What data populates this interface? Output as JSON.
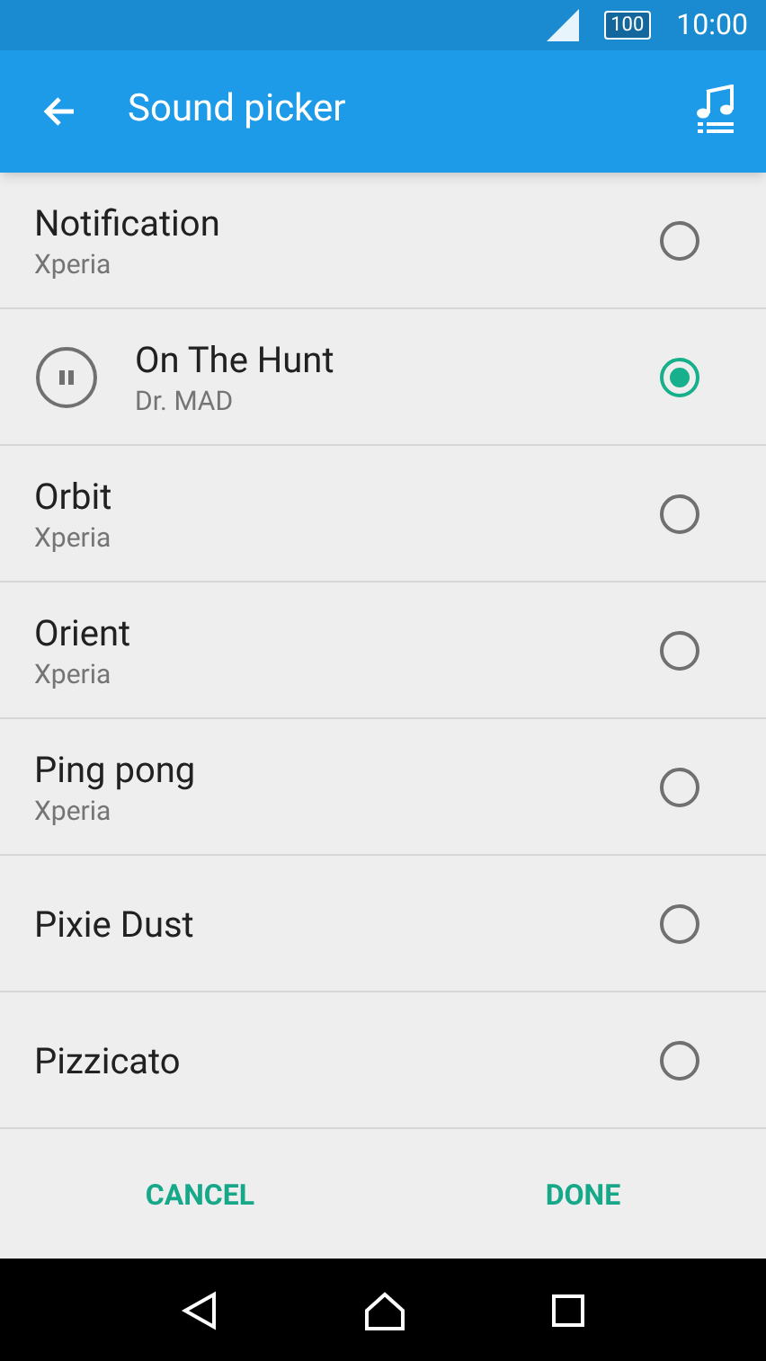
{
  "status_bar": {
    "battery": "100",
    "time": "10:00"
  },
  "app_bar": {
    "title": "Sound picker"
  },
  "sounds": [
    {
      "title": "Notification",
      "subtitle": "Xperia",
      "playing": false,
      "selected": false
    },
    {
      "title": "On The Hunt",
      "subtitle": "Dr. MAD",
      "playing": true,
      "selected": true
    },
    {
      "title": "Orbit",
      "subtitle": "Xperia",
      "playing": false,
      "selected": false
    },
    {
      "title": "Orient",
      "subtitle": "Xperia",
      "playing": false,
      "selected": false
    },
    {
      "title": "Ping pong",
      "subtitle": "Xperia",
      "playing": false,
      "selected": false
    },
    {
      "title": "Pixie Dust",
      "playing": false,
      "selected": false
    },
    {
      "title": "Pizzicato",
      "playing": false,
      "selected": false
    }
  ],
  "buttons": [
    "CANCEL",
    "DONE"
  ]
}
